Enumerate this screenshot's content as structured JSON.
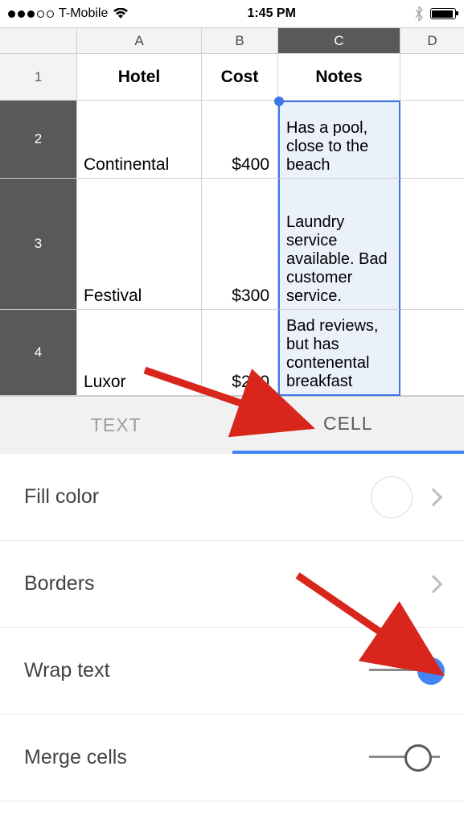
{
  "statusbar": {
    "carrier": "T-Mobile",
    "time": "1:45 PM"
  },
  "sheet": {
    "columns": [
      "A",
      "B",
      "C",
      "D"
    ],
    "rownums": [
      "1",
      "2",
      "3",
      "4"
    ],
    "headers": {
      "a": "Hotel",
      "b": "Cost",
      "c": "Notes"
    },
    "rows": [
      {
        "a": "Continental",
        "b": "$400",
        "c": "Has a pool, close to the beach"
      },
      {
        "a": "Festival",
        "b": "$300",
        "c": "Laundry service available. Bad customer service."
      },
      {
        "a": "Luxor",
        "b": "$200",
        "c": "Bad reviews, but has contenental breakfast"
      }
    ]
  },
  "tabs": {
    "text": "TEXT",
    "cell": "CELL"
  },
  "options": {
    "fill_color": "Fill color",
    "borders": "Borders",
    "wrap_text": "Wrap text",
    "merge_cells": "Merge cells"
  }
}
